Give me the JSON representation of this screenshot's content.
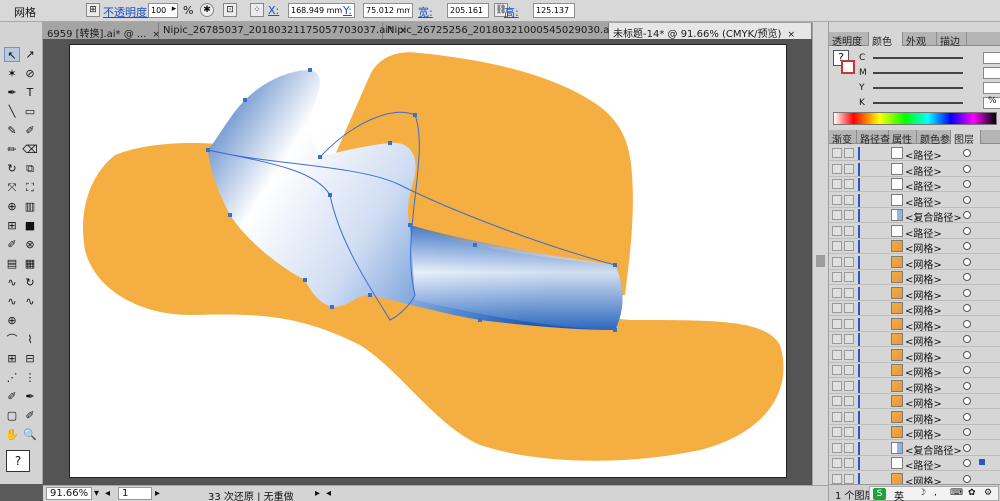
{
  "control_bar": {
    "tool_name": "网格",
    "opacity_label": "不透明度:",
    "opacity_value": "100",
    "opacity_unit": "%",
    "x_label": "X:",
    "x_value": "168.949 mm",
    "y_label": "Y:",
    "y_value": "75.012 mm",
    "w_label": "宽:",
    "w_value": "205.161 m",
    "h_label": "高:",
    "h_value": "125.137 mm"
  },
  "tabs": [
    {
      "label": "6959 [转换].ai* @ ...",
      "close": "×"
    },
    {
      "label": "Nipic_26785037_20180321175057703037.ai*",
      "close": "×"
    },
    {
      "label": "Nipic_26725256_20180321000545029030.ai*",
      "close": "×"
    },
    {
      "label": "未标题-14* @ 91.66% (CMYK/预览)",
      "close": "×"
    }
  ],
  "tools": [
    [
      "↖",
      "↗"
    ],
    [
      "✶",
      "⊘"
    ],
    [
      "✒",
      "T"
    ],
    [
      "╲",
      "▭"
    ],
    [
      "✎",
      "✐"
    ],
    [
      "✏",
      "⌫"
    ],
    [
      "↻",
      "⧉"
    ],
    [
      "⤧",
      "⛶"
    ],
    [
      "⊕",
      "▥"
    ],
    [
      "⊞",
      "■"
    ],
    [
      "✐",
      "⊗"
    ],
    [
      "▤",
      "▦"
    ],
    [
      "∿",
      "↻"
    ],
    [
      "∿",
      "∿"
    ],
    [
      "⊕",
      ""
    ],
    [
      "⌒",
      "⌇"
    ],
    [
      "⊞",
      "⊟"
    ],
    [
      "⋰",
      "⋮"
    ],
    [
      "✐",
      "✒"
    ],
    [
      "▢",
      "✐"
    ],
    [
      "✋",
      "🔍"
    ]
  ],
  "status": {
    "zoom": "91.66%",
    "page": "1",
    "message": "33 次还原 | 无重做"
  },
  "panels": {
    "tabs_top": [
      "透明度",
      "颜色",
      "外观",
      "描边"
    ],
    "active_top": "颜色",
    "color_rows": [
      {
        "label": "C",
        "value": ""
      },
      {
        "label": "M",
        "value": ""
      },
      {
        "label": "Y",
        "value": ""
      },
      {
        "label": "K",
        "value": "0"
      }
    ],
    "percent": "%",
    "tabs_mid": [
      "渐变",
      "路径查",
      "属性",
      "颜色参",
      "图层"
    ],
    "active_mid": "图层",
    "layers": [
      {
        "name": "<路径>",
        "type": "path"
      },
      {
        "name": "<路径>",
        "type": "path"
      },
      {
        "name": "<路径>",
        "type": "path"
      },
      {
        "name": "<路径>",
        "type": "path"
      },
      {
        "name": "<复合路径>",
        "type": "compound"
      },
      {
        "name": "<路径>",
        "type": "path"
      },
      {
        "name": "<网格>",
        "type": "mesh"
      },
      {
        "name": "<网格>",
        "type": "mesh"
      },
      {
        "name": "<网格>",
        "type": "mesh"
      },
      {
        "name": "<网格>",
        "type": "mesh"
      },
      {
        "name": "<网格>",
        "type": "mesh"
      },
      {
        "name": "<网格>",
        "type": "mesh"
      },
      {
        "name": "<网格>",
        "type": "mesh"
      },
      {
        "name": "<网格>",
        "type": "mesh"
      },
      {
        "name": "<网格>",
        "type": "mesh"
      },
      {
        "name": "<网格>",
        "type": "mesh"
      },
      {
        "name": "<网格>",
        "type": "mesh"
      },
      {
        "name": "<网格>",
        "type": "mesh"
      },
      {
        "name": "<网格>",
        "type": "mesh"
      },
      {
        "name": "<复合路径>",
        "type": "compound"
      },
      {
        "name": "<路径>",
        "type": "path"
      },
      {
        "name": "<网格>",
        "type": "mesh"
      }
    ],
    "footer": "1 个图层",
    "ime_label": "英"
  },
  "colors": {
    "hat_fill": "#f4ae42",
    "ribbon_blue": "#2f6fc4",
    "selection": "#3a6fd1"
  }
}
